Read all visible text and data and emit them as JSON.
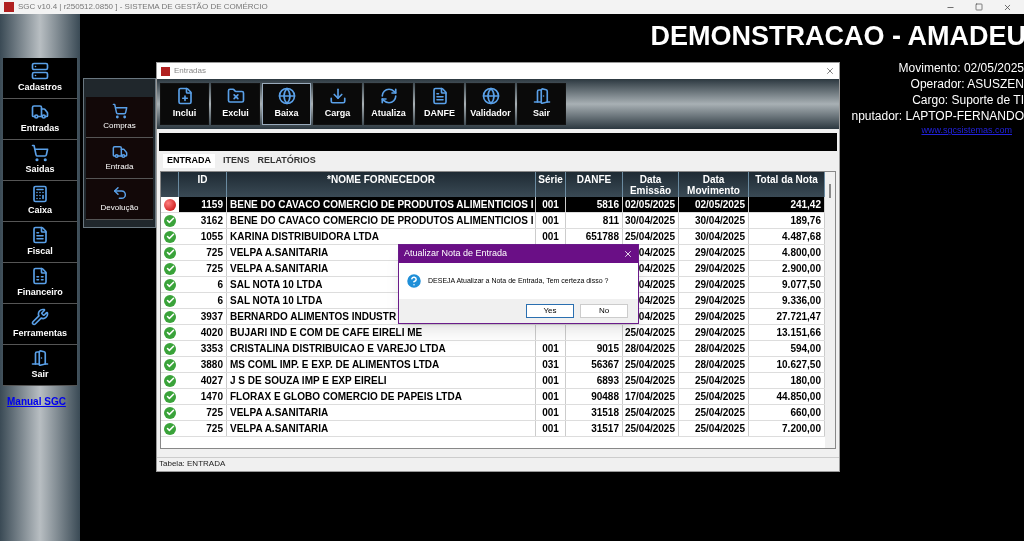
{
  "app_title": "SGC v10.4 | r250512.0850 ] - SISTEMA DE GESTÃO DE COMÉRCIO",
  "sidebar": {
    "items": [
      {
        "label": "Cadastros",
        "kind": "records"
      },
      {
        "label": "Entradas",
        "kind": "truck"
      },
      {
        "label": "Saidas",
        "kind": "cart"
      },
      {
        "label": "Caixa",
        "kind": "register"
      },
      {
        "label": "Fiscal",
        "kind": "fiscal"
      },
      {
        "label": "Financeiro",
        "kind": "finance"
      },
      {
        "label": "Ferramentas",
        "kind": "tools"
      },
      {
        "label": "Sair",
        "kind": "exit"
      }
    ],
    "link": "Manual SGC"
  },
  "submenu": [
    {
      "label": "Compras",
      "kind": "cart"
    },
    {
      "label": "Entrada",
      "kind": "truck"
    },
    {
      "label": "Devolução",
      "kind": "return"
    }
  ],
  "header": {
    "company": "DEMONSTRACAO - AMADEU",
    "info": [
      "Movimento: 02/05/2025",
      "Operador: ASUSZEN",
      "Cargo: Suporte de TI",
      "nputador: LAPTOP-FERNANDO"
    ],
    "link": "www.sgcsistemas.com"
  },
  "window": {
    "title": "Entradas",
    "toolbar": [
      {
        "label": "Inclui",
        "kind": "add",
        "selected": false
      },
      {
        "label": "Exclui",
        "kind": "delete",
        "selected": false
      },
      {
        "label": "Baixa",
        "kind": "globe",
        "selected": true
      },
      {
        "label": "Carga",
        "kind": "load",
        "selected": false
      },
      {
        "label": "Atualiza",
        "kind": "refresh",
        "selected": false
      },
      {
        "label": "DANFE",
        "kind": "doc",
        "selected": false
      },
      {
        "label": "Validador",
        "kind": "globe",
        "selected": false
      },
      {
        "label": "Sair",
        "kind": "exit",
        "selected": false
      }
    ],
    "tabs": [
      {
        "label": "ENTRADA",
        "selected": true
      },
      {
        "label": "ITENS",
        "selected": false
      },
      {
        "label": "RELATÓRIOS",
        "selected": false
      }
    ],
    "table": {
      "columns": [
        "ID",
        "*NOME FORNECEDOR",
        "Série",
        "DANFE",
        "Data Emissão",
        "Data Movimento",
        "Total da Nota"
      ],
      "rows": [
        {
          "kind": "pending",
          "selected": true,
          "cells": [
            "1159",
            "BENE DO CAVACO COMERCIO DE PRODUTOS ALIMENTICIOS I",
            "001",
            "5816",
            "02/05/2025",
            "02/05/2025",
            "241,42"
          ]
        },
        {
          "kind": "ok",
          "selected": false,
          "cells": [
            "3162",
            "BENE DO CAVACO COMERCIO DE PRODUTOS ALIMENTICIOS I",
            "001",
            "811",
            "30/04/2025",
            "30/04/2025",
            "189,76"
          ]
        },
        {
          "kind": "ok",
          "selected": false,
          "cells": [
            "1055",
            "KARINA DISTRIBUIDORA LTDA",
            "001",
            "651788",
            "25/04/2025",
            "30/04/2025",
            "4.487,68"
          ]
        },
        {
          "kind": "ok",
          "selected": false,
          "cells": [
            "725",
            "VELPA A.SANITARIA",
            "",
            "",
            "04/2025",
            "29/04/2025",
            "4.800,00"
          ]
        },
        {
          "kind": "ok",
          "selected": false,
          "cells": [
            "725",
            "VELPA A.SANITARIA",
            "",
            "",
            "04/2025",
            "29/04/2025",
            "2.900,00"
          ]
        },
        {
          "kind": "ok",
          "selected": false,
          "cells": [
            "6",
            "SAL NOTA 10 LTDA",
            "",
            "",
            "04/2025",
            "29/04/2025",
            "9.077,50"
          ]
        },
        {
          "kind": "ok",
          "selected": false,
          "cells": [
            "6",
            "SAL NOTA 10 LTDA",
            "",
            "",
            "04/2025",
            "29/04/2025",
            "9.336,00"
          ]
        },
        {
          "kind": "ok",
          "selected": false,
          "cells": [
            "3937",
            "BERNARDO ALIMENTOS INDUSTR",
            "",
            "",
            "04/2025",
            "29/04/2025",
            "27.721,47"
          ]
        },
        {
          "kind": "ok",
          "selected": false,
          "cells": [
            "4020",
            "BUJARI IND E COM DE CAFE EIRELI ME",
            "",
            "",
            "25/04/2025",
            "29/04/2025",
            "13.151,66"
          ]
        },
        {
          "kind": "ok",
          "selected": false,
          "cells": [
            "3353",
            "CRISTALINA DISTRIBUICAO E VAREJO LTDA",
            "001",
            "9015",
            "28/04/2025",
            "28/04/2025",
            "594,00"
          ]
        },
        {
          "kind": "ok",
          "selected": false,
          "cells": [
            "3880",
            "MS COML IMP. E EXP. DE ALIMENTOS LTDA",
            "031",
            "56367",
            "25/04/2025",
            "28/04/2025",
            "10.627,50"
          ]
        },
        {
          "kind": "ok",
          "selected": false,
          "cells": [
            "4027",
            "J S DE SOUZA IMP E EXP EIRELI",
            "001",
            "6893",
            "25/04/2025",
            "25/04/2025",
            "180,00"
          ]
        },
        {
          "kind": "ok",
          "selected": false,
          "cells": [
            "1470",
            "FLORAX E GLOBO COMERCIO DE PAPEIS LTDA",
            "001",
            "90488",
            "17/04/2025",
            "25/04/2025",
            "44.850,00"
          ]
        },
        {
          "kind": "ok",
          "selected": false,
          "cells": [
            "725",
            "VELPA A.SANITARIA",
            "001",
            "31518",
            "25/04/2025",
            "25/04/2025",
            "660,00"
          ]
        },
        {
          "kind": "ok",
          "selected": false,
          "cells": [
            "725",
            "VELPA A.SANITARIA",
            "001",
            "31517",
            "25/04/2025",
            "25/04/2025",
            "7.200,00"
          ]
        }
      ]
    },
    "status_bar": "Tabela: ENTRADA"
  },
  "dialog": {
    "title": "Atualizar Nota de Entrada",
    "message": "DESEJA Atualizar a Nota de Entrada, Tem certeza disso ?",
    "buttons": [
      {
        "label": "Yes",
        "selected": true
      },
      {
        "label": "No",
        "selected": false
      }
    ]
  }
}
